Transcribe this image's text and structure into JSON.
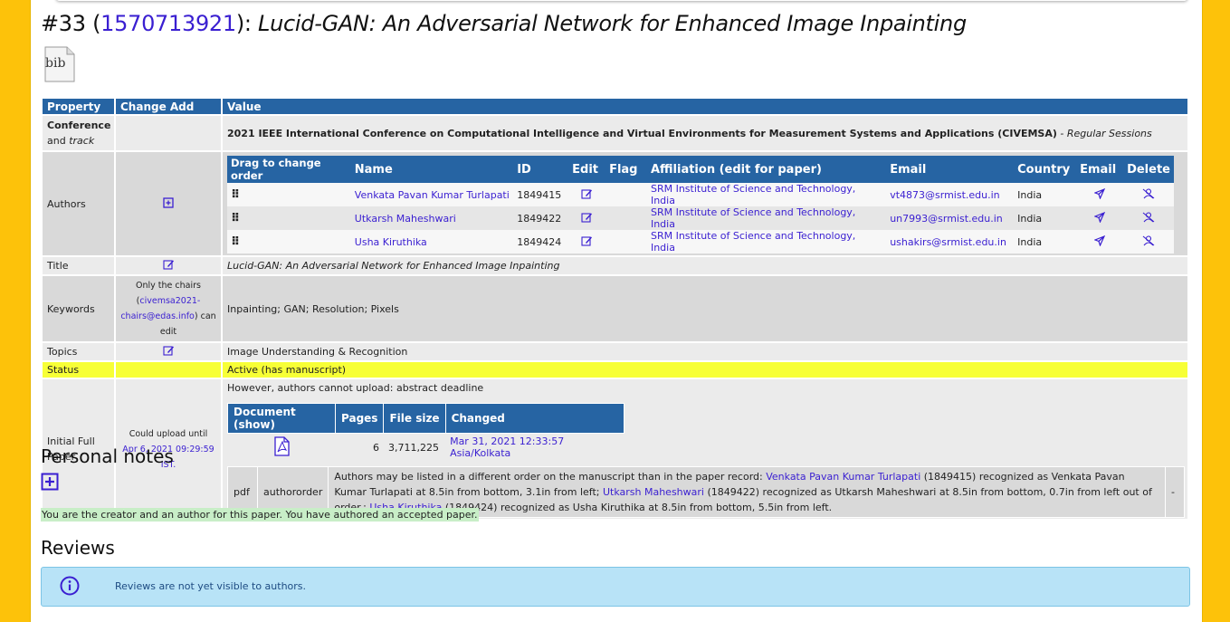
{
  "header": {
    "number": "#33",
    "paper_id": "1570713921",
    "title": "Lucid-GAN: An Adversarial Network for Enhanced Image Inpainting",
    "bib_label": "bib"
  },
  "table": {
    "headers": {
      "property": "Property",
      "change_add": "Change Add",
      "value": "Value"
    },
    "conference": {
      "label1": "Conference",
      "label_and": "and",
      "label_track": "track",
      "value": "2021 IEEE International Conference on Computational Intelligence and Virtual Environments for Measurement Systems and Applications (CIVEMSA)",
      "track": "- Regular Sessions"
    },
    "authors": {
      "label": "Authors",
      "columns": [
        "Drag to change order",
        "Name",
        "ID",
        "Edit",
        "Flag",
        "Affiliation (edit for paper)",
        "Email",
        "Country",
        "Email",
        "Delete"
      ],
      "rows": [
        {
          "name": "Venkata Pavan Kumar Turlapati",
          "id": "1849415",
          "affiliation": "SRM Institute of Science and Technology, India",
          "email": "vt4873@srmist.edu.in",
          "country": "India"
        },
        {
          "name": "Utkarsh Maheshwari",
          "id": "1849422",
          "affiliation": "SRM Institute of Science and Technology, India",
          "email": "un7993@srmist.edu.in",
          "country": "India"
        },
        {
          "name": "Usha Kiruthika",
          "id": "1849424",
          "affiliation": "SRM Institute of Science and Technology, India",
          "email": "ushakirs@srmist.edu.in",
          "country": "India"
        }
      ]
    },
    "title_row": {
      "label": "Title",
      "value": "Lucid-GAN: An Adversarial Network for Enhanced Image Inpainting"
    },
    "keywords": {
      "label": "Keywords",
      "note_pre": "Only the chairs (",
      "note_link": "civemsa2021-chairs@edas.info",
      "note_post": ") can edit",
      "value": "Inpainting; GAN; Resolution; Pixels"
    },
    "topics": {
      "label": "Topics",
      "value": "Image Understanding & Recognition"
    },
    "status": {
      "label": "Status",
      "value": "Active (has manuscript)"
    },
    "paper": {
      "label": "Initial Full Paper",
      "upload_pre": "Could upload until",
      "upload_date": "Apr 6, 2021 09:29:59 IST.",
      "notice": "However, authors cannot upload: abstract deadline",
      "doc_headers": [
        "Document (show)",
        "Pages",
        "File size",
        "Changed"
      ],
      "pages": "6",
      "file_size": "3,711,225",
      "changed": "Mar 31, 2021 12:33:57 Asia/Kolkata",
      "rec_type": "pdf",
      "rec_check": "authororder",
      "rec_text1": "Authors may be listed in a different order on the manuscript than in the paper record:",
      "rec_a1": "Venkata Pavan Kumar Turlapati",
      "rec_text2": "(1849415) recognized as Venkata Pavan Kumar Turlapati at 8.5in from bottom, 3.1in from left;",
      "rec_a2": "Utkarsh Maheshwari",
      "rec_text3": "(1849422) recognized as Utkarsh Maheshwari at 8.5in from bottom, 0.7in from left out of order.;",
      "rec_a3": "Usha Kiruthika",
      "rec_text4": "(1849424) recognized as Usha Kiruthika at 8.5in from bottom, 5.5in from left.",
      "rec_dash": "-"
    }
  },
  "personal_notes": {
    "heading": "Personal notes"
  },
  "creator_note": "You are the creator and an author for this paper. You have authored an accepted paper.",
  "reviews": {
    "heading": "Reviews",
    "message": "Reviews are not yet visible to authors."
  },
  "colors": {
    "header_blue": "#2664a3",
    "link": "#3a1fd1",
    "status_yellow": "#f7ff36",
    "border_gold": "#fdc20a"
  }
}
